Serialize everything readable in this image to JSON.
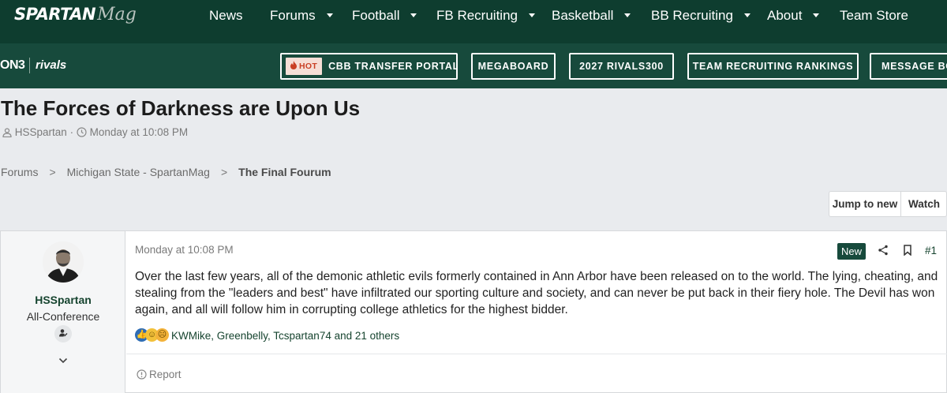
{
  "site": {
    "logo_main": "SPARTAN",
    "logo_sub": "Mag"
  },
  "nav": {
    "items": [
      {
        "label": "News",
        "has_dropdown": false
      },
      {
        "label": "Forums",
        "has_dropdown": true
      },
      {
        "label": "Football",
        "has_dropdown": true
      },
      {
        "label": "FB Recruiting",
        "has_dropdown": true
      },
      {
        "label": "Basketball",
        "has_dropdown": true
      },
      {
        "label": "BB Recruiting",
        "has_dropdown": true
      },
      {
        "label": "About",
        "has_dropdown": true
      },
      {
        "label": "Team Store",
        "has_dropdown": false
      }
    ]
  },
  "subnav": {
    "on3_label": "ON3",
    "rivals_label": "rivals",
    "hot_badge": "HOT",
    "links": [
      {
        "label": "CBB TRANSFER PORTAL"
      },
      {
        "label": "MEGABOARD"
      },
      {
        "label": "2027 RIVALS300"
      },
      {
        "label": "TEAM RECRUITING RANKINGS"
      },
      {
        "label": "MESSAGE BO"
      }
    ]
  },
  "thread": {
    "title": "The Forces of Darkness are Upon Us",
    "author": "HSSpartan",
    "meta_separator": "·",
    "date": "Monday at 10:08 PM"
  },
  "breadcrumb": {
    "items": [
      "Forums",
      "Michigan State - SpartanMag",
      "The Final Fourum"
    ],
    "separator": ">"
  },
  "actions": {
    "jump_to_new": "Jump to new",
    "watch": "Watch"
  },
  "post": {
    "author": "HSSpartan",
    "user_title": "All-Conference",
    "date": "Monday at 10:08 PM",
    "new_badge": "New",
    "number": "#1",
    "body": "Over the last few years, all of the demonic athletic evils formerly contained in Ann Arbor have been released on to the world. The lying, cheating, and stealing from the \"leaders and best\" have infiltrated our sporting culture and society, and can never be put back in their fiery hole. The Devil has won again, and all will follow him in corrupting college athletics for the highest bidder.",
    "reactions_text": "KWMike, Greenbelly, Tcspartan74 and 21 others",
    "report_label": "Report"
  },
  "colors": {
    "nav_bg": "#0e3d2f",
    "subnav_bg": "#174a3c",
    "accent_green": "#16442f",
    "hot_red": "#c93f24"
  }
}
